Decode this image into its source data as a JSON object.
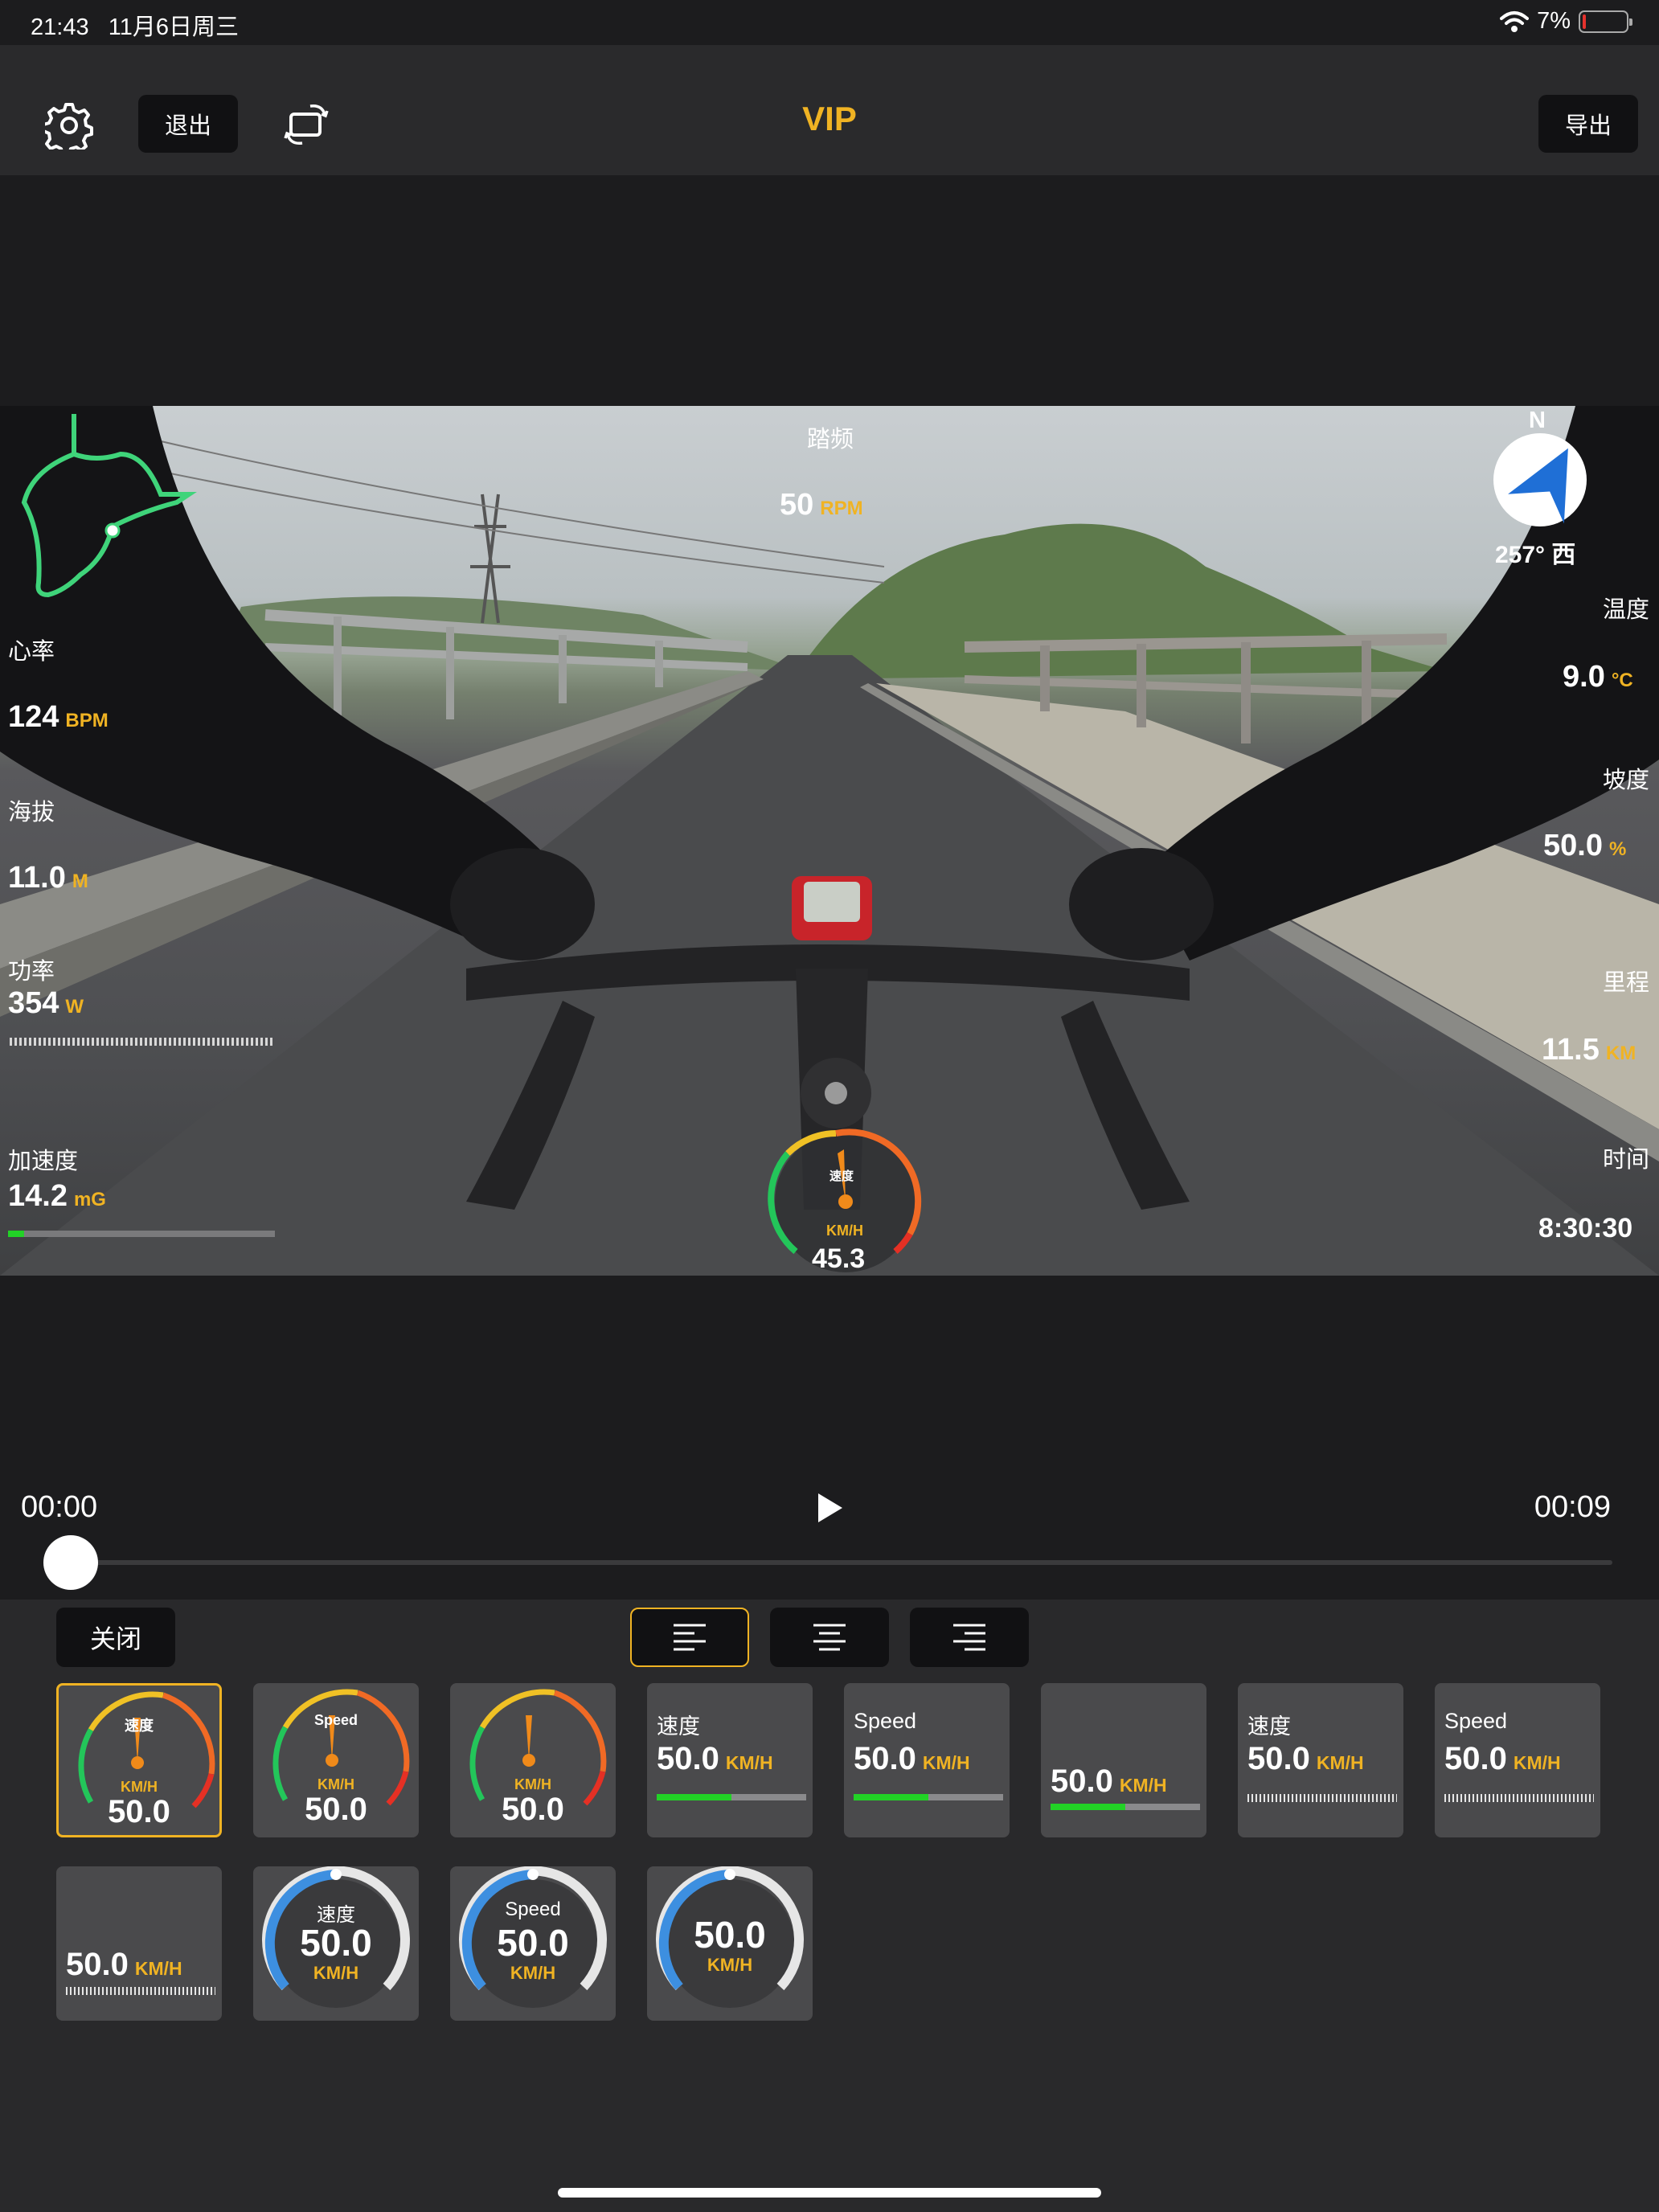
{
  "status_bar": {
    "time": "21:43",
    "date": "11月6日周三",
    "battery": "7%",
    "battery_level": 0.07
  },
  "top_bar": {
    "exit_label": "退出",
    "title": "VIP",
    "export_label": "导出"
  },
  "video": {
    "compass": {
      "north": "N",
      "heading": "257° 西"
    },
    "cadence": {
      "label": "踏频",
      "value": "50",
      "unit": "RPM"
    },
    "heart_rate": {
      "label": "心率",
      "value": "124",
      "unit": "BPM"
    },
    "altitude": {
      "label": "海拔",
      "value": "11.0",
      "unit": "M"
    },
    "power": {
      "label": "功率",
      "value": "354",
      "unit": "W"
    },
    "acceleration": {
      "label": "加速度",
      "value": "14.2",
      "unit": "mG",
      "level": 0.06
    },
    "temperature": {
      "label": "温度",
      "value": "9.0",
      "unit": "°C"
    },
    "slope": {
      "label": "坡度",
      "value": "50.0",
      "unit": "%"
    },
    "distance": {
      "label": "里程",
      "value": "11.5",
      "unit": "KM"
    },
    "time": {
      "label": "时间",
      "value": "8:30:30"
    },
    "speed_gauge": {
      "label": "速度",
      "unit": "KM/H",
      "value": "45.3"
    }
  },
  "playback": {
    "current": "00:00",
    "total": "00:09",
    "progress": 0.0
  },
  "panel": {
    "close_label": "关闭",
    "align_buttons": [
      "left",
      "center",
      "right"
    ],
    "selected_align": "left",
    "styles": [
      {
        "type": "dial",
        "label": "速度",
        "unit": "KM/H",
        "value": "50.0",
        "selected": true
      },
      {
        "type": "dial",
        "label": "Speed",
        "unit": "KM/H",
        "value": "50.0"
      },
      {
        "type": "dial",
        "label": "",
        "unit": "KM/H",
        "value": "50.0"
      },
      {
        "type": "bar",
        "label": "速度",
        "value": "50.0",
        "unit": "KM/H",
        "level": 0.5
      },
      {
        "type": "bar",
        "label": "Speed",
        "value": "50.0",
        "unit": "KM/H",
        "level": 0.5
      },
      {
        "type": "bar",
        "label": "",
        "value": "50.0",
        "unit": "KM/H",
        "level": 0.5
      },
      {
        "type": "ticks",
        "label": "速度",
        "value": "50.0",
        "unit": "KM/H"
      },
      {
        "type": "ticks",
        "label": "Speed",
        "value": "50.0",
        "unit": "KM/H"
      },
      {
        "type": "ticks",
        "label": "",
        "value": "50.0",
        "unit": "KM/H"
      },
      {
        "type": "arc",
        "label": "速度",
        "value": "50.0",
        "unit": "KM/H",
        "level": 0.5
      },
      {
        "type": "arc",
        "label": "Speed",
        "value": "50.0",
        "unit": "KM/H",
        "level": 0.5
      },
      {
        "type": "arc",
        "label": "",
        "value": "50.0",
        "unit": "KM/H",
        "level": 0.5
      }
    ],
    "dial_ticks": [
      "0",
      "10",
      "20",
      "30",
      "40",
      "50",
      "60",
      "70",
      "80",
      "90",
      "100"
    ]
  },
  "colors": {
    "accent": "#f0b323",
    "bar_green": "#22d226",
    "arc_blue": "#3d8fe0",
    "route": "#3fd47a"
  }
}
